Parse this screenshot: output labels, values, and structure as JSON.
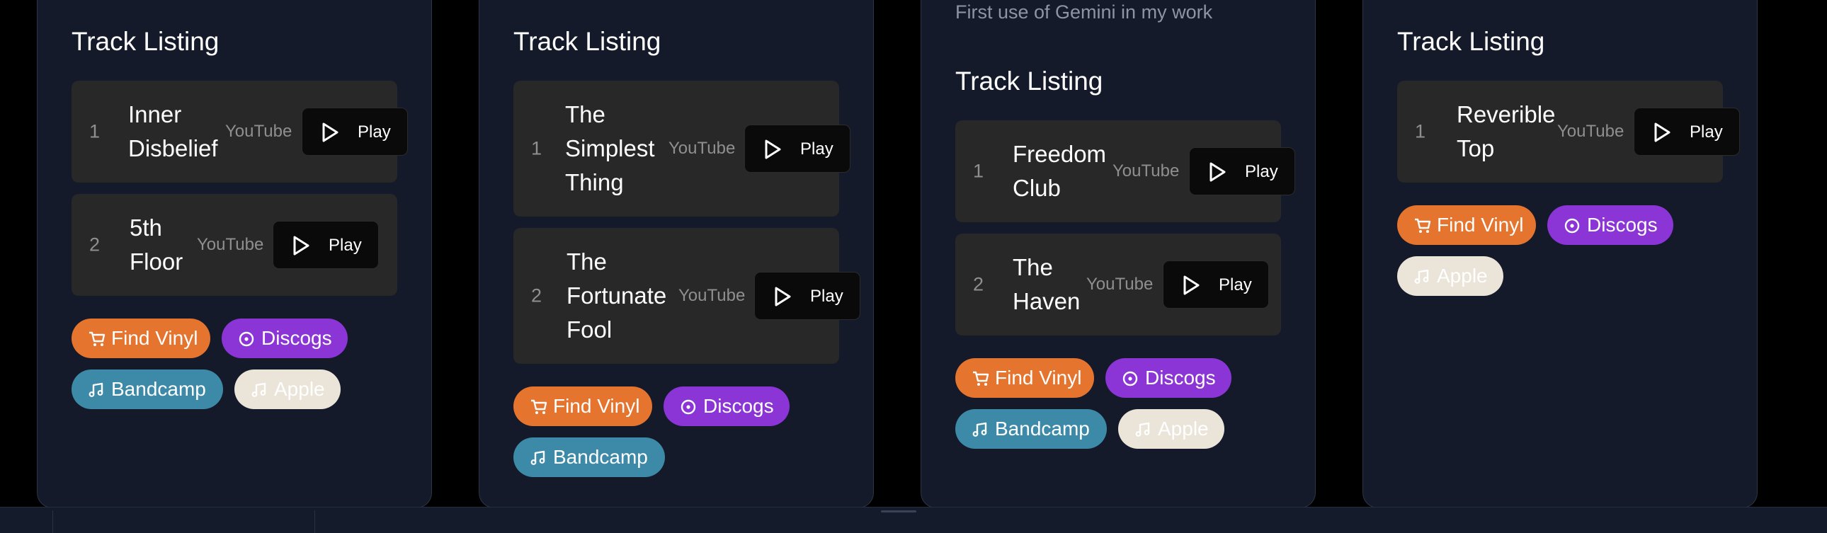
{
  "cards": [
    {
      "heading": "Track Listing",
      "tracks": [
        {
          "num": "1",
          "title": [
            "Inner",
            "Disbelief"
          ],
          "source": "YouTube",
          "play": "Play"
        },
        {
          "num": "2",
          "title": [
            "5th",
            "Floor"
          ],
          "source": "YouTube",
          "play": "Play"
        }
      ],
      "links": {
        "vinyl": "Find Vinyl",
        "discogs": "Discogs",
        "bandcamp": "Bandcamp",
        "apple": "Apple"
      }
    },
    {
      "heading": "Track Listing",
      "tracks": [
        {
          "num": "1",
          "title": [
            "The",
            "Simplest",
            "Thing"
          ],
          "source": "YouTube",
          "play": "Play"
        },
        {
          "num": "2",
          "title": [
            "The",
            "Fortunate",
            "Fool"
          ],
          "source": "YouTube",
          "play": "Play"
        }
      ],
      "links": {
        "vinyl": "Find Vinyl",
        "discogs": "Discogs",
        "bandcamp": "Bandcamp"
      }
    },
    {
      "subtitle": "First use of Gemini in my work",
      "heading": "Track Listing",
      "tracks": [
        {
          "num": "1",
          "title": [
            "Freedom",
            "Club"
          ],
          "source": "YouTube",
          "play": "Play"
        },
        {
          "num": "2",
          "title": [
            "The",
            "Haven"
          ],
          "source": "YouTube",
          "play": "Play"
        }
      ],
      "links": {
        "vinyl": "Find Vinyl",
        "discogs": "Discogs",
        "bandcamp": "Bandcamp",
        "apple": "Apple"
      }
    },
    {
      "heading": "Track Listing",
      "tracks": [
        {
          "num": "1",
          "title": [
            "Reverible",
            "Top"
          ],
          "source": "YouTube",
          "play": "Play"
        }
      ],
      "links": {
        "vinyl": "Find Vinyl",
        "discogs": "Discogs",
        "apple": "Apple"
      }
    }
  ],
  "icons": {
    "play": "play-icon",
    "cart": "cart-icon",
    "record": "record-icon",
    "music": "music-note-icon"
  },
  "colors": {
    "vinyl": "#e4742e",
    "discogs": "#8b35d6",
    "bandcamp": "#3c8aa8",
    "apple": "#eae5d8",
    "card_bg": "#141a29",
    "row_bg": "#282828"
  }
}
